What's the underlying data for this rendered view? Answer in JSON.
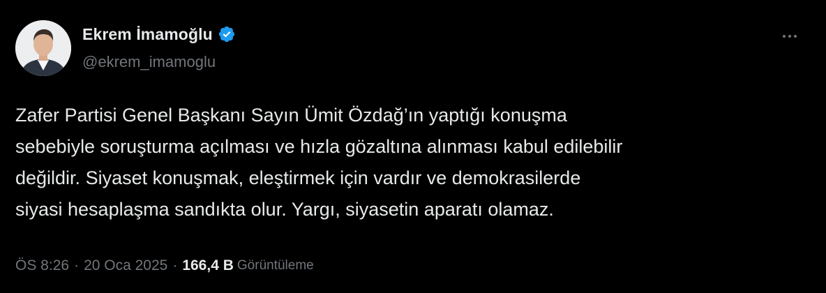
{
  "author": {
    "display_name": "Ekrem İmamoğlu",
    "handle": "@ekrem_imamoglu",
    "verified_icon": "verified-badge-icon",
    "avatar_icon": "avatar"
  },
  "tweet": {
    "lines": [
      "Zafer Partisi Genel Başkanı Sayın Ümit Özdağ’ın yaptığı konuşma",
      "sebebiyle soruşturma açılması ve hızla gözaltına alınması kabul edilebilir",
      "değildir. Siyaset konuşmak, eleştirmek için vardır ve demokrasilerde",
      "siyasi hesaplaşma sandıkta olur. Yargı, siyasetin aparatı olamaz."
    ]
  },
  "meta": {
    "time": "ÖS 8:26",
    "separator": "·",
    "date": "20 Oca 2025",
    "views_count": "166,4 B",
    "views_label": "Görüntüleme"
  },
  "menu": {
    "icon": "more-options-icon"
  },
  "colors": {
    "background": "#000000",
    "primary_text": "#e7e9ea",
    "secondary_text": "#71767b",
    "verified_blue": "#1d9bf0"
  }
}
